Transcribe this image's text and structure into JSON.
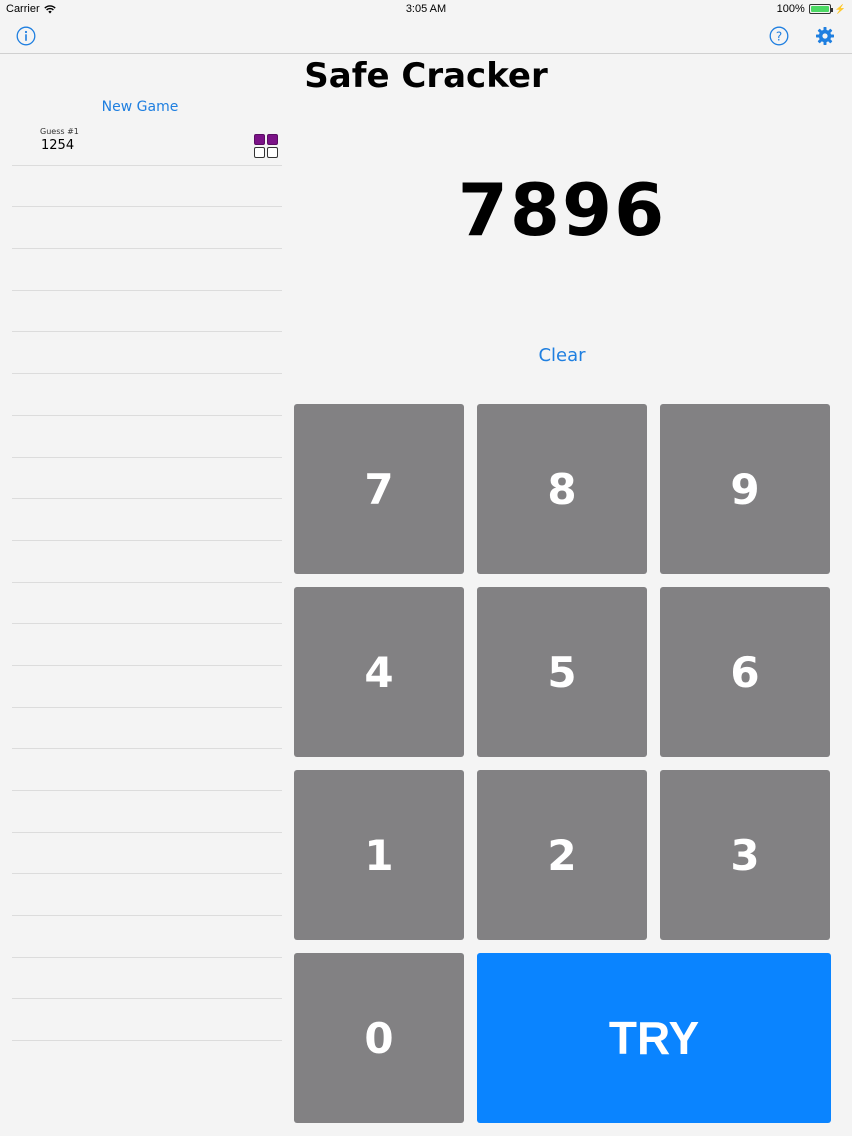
{
  "status_bar": {
    "carrier": "Carrier",
    "time": "3:05 AM",
    "battery": "100%"
  },
  "nav": {
    "info_icon": "info-icon",
    "help_icon": "help-icon",
    "settings_icon": "gear-icon"
  },
  "title": "Safe Cracker",
  "new_game_label": "New Game",
  "guesses": [
    {
      "label": "Guess #1",
      "value": "1254",
      "pegs": [
        "filled",
        "filled",
        "empty",
        "empty"
      ]
    }
  ],
  "current_guess": "7896",
  "clear_label": "Clear",
  "keys": {
    "k7": "7",
    "k8": "8",
    "k9": "9",
    "k4": "4",
    "k5": "5",
    "k6": "6",
    "k1": "1",
    "k2": "2",
    "k3": "3",
    "k0": "0"
  },
  "try_label": "TRY",
  "colors": {
    "accent": "#1f7fe0",
    "key": "#828183",
    "try": "#0a84ff",
    "peg": "#7b1287"
  }
}
